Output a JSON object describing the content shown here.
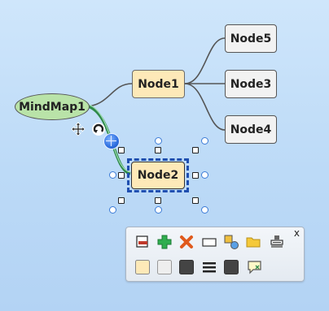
{
  "mindmap": {
    "root": "MindMap1",
    "nodes": {
      "node1": "Node1",
      "node2": "Node2",
      "node3": "Node3",
      "node4": "Node4",
      "node5": "Node5"
    }
  },
  "toolbar": {
    "close_label": "x",
    "colors": {
      "fill_swatch": "#fde9b8",
      "light_swatch": "#eeeeee",
      "dark_swatch": "#444444"
    }
  }
}
